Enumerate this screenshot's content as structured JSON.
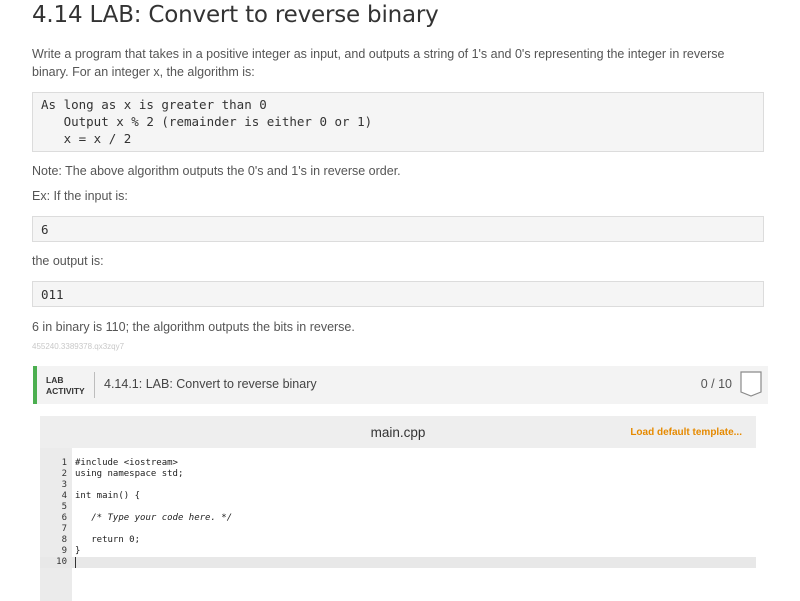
{
  "title": "4.14 LAB: Convert to reverse binary",
  "intro": "Write a program that takes in a positive integer as input, and outputs a string of 1's and 0's representing the integer in reverse binary. For an integer x, the algorithm is:",
  "algorithm": [
    "As long as x is greater than 0",
    "   Output x % 2 (remainder is either 0 or 1)",
    "   x = x / 2"
  ],
  "note": "Note: The above algorithm outputs the 0's and 1's in reverse order.",
  "example_intro": "Ex: If the input is:",
  "example_input": "6",
  "output_intro": "the output is:",
  "example_output": "011",
  "explanation": "6 in binary is 110; the algorithm outputs the bits in reverse.",
  "watermark": "455240.3389378.qx3zqy7",
  "lab": {
    "tag_line1": "LAB",
    "tag_line2": "ACTIVITY",
    "title": "4.14.1: LAB: Convert to reverse binary",
    "score": "0 / 10"
  },
  "editor": {
    "filename": "main.cpp",
    "load_label": "Load default template...",
    "line_numbers": [
      "1",
      "2",
      "3",
      "4",
      "5",
      "6",
      "7",
      "8",
      "9",
      "10"
    ],
    "lines": [
      "#include <iostream>",
      "using namespace std;",
      "",
      "int main() {",
      "",
      "   /* Type your code here. */",
      "",
      "   return 0;",
      "}",
      ""
    ]
  },
  "colors": {
    "lab_accent": "#4caf50",
    "load_link": "#e68a00"
  }
}
